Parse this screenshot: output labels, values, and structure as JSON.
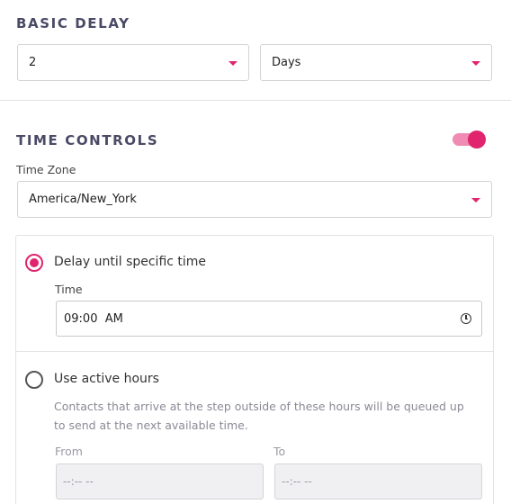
{
  "basic_delay": {
    "title": "BASIC DELAY",
    "amount": {
      "value": "2"
    },
    "unit": {
      "value": "Days"
    }
  },
  "time_controls": {
    "title": "TIME CONTROLS",
    "enabled": true,
    "time_zone": {
      "label": "Time Zone",
      "value": "America/New_York"
    },
    "options": {
      "specific_time": {
        "label": "Delay until specific time",
        "selected": true,
        "time_label": "Time",
        "time_value": "09:00  AM"
      },
      "active_hours": {
        "label": "Use active hours",
        "selected": false,
        "description": "Contacts that arrive at the step outside of these hours will be queued up to send at the next available time.",
        "from_label": "From",
        "from_placeholder": "--:-- --",
        "to_label": "To",
        "to_placeholder": "--:-- --"
      }
    }
  },
  "colors": {
    "accent": "#e0246e",
    "toggle_track": "#f08bb3",
    "heading": "#4a4a66"
  }
}
